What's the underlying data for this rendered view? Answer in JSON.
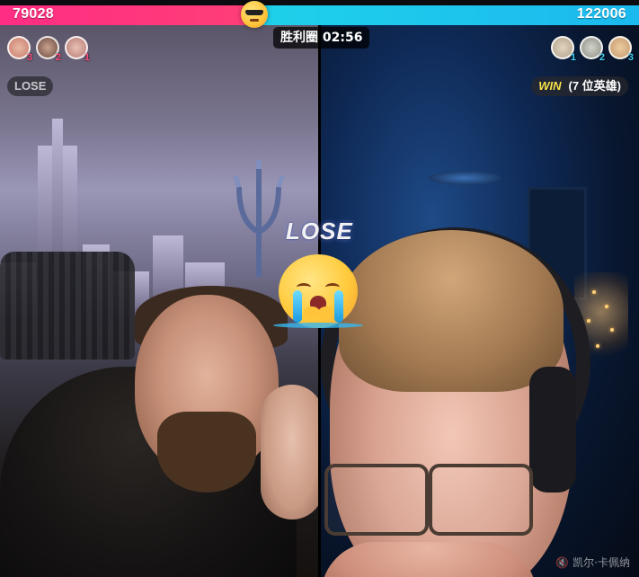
{
  "scores": {
    "left": "79028",
    "right": "122006"
  },
  "timer": "胜利圈 02:56",
  "avatars": {
    "left": [
      {
        "rank": "3",
        "color": "#c97a6a"
      },
      {
        "rank": "2",
        "color": "#6b4b3f"
      },
      {
        "rank": "1",
        "color": "#b57a76"
      }
    ],
    "right": [
      {
        "rank": "1",
        "color": "#b0a189"
      },
      {
        "rank": "2",
        "color": "#8d8f86"
      },
      {
        "rank": "3",
        "color": "#c49a6c"
      }
    ]
  },
  "badges": {
    "left": "LOSE",
    "right_win": "WIN",
    "right_detail": "(7 位英雄)"
  },
  "center": {
    "lose_text": "LOSE",
    "emoji": "crying-face-emoji"
  },
  "watermark": "凯尔·卡佩纳",
  "colors": {
    "left_bar": "#ff2d84",
    "right_bar": "#1fd1ea",
    "win": "#f7e24a"
  }
}
